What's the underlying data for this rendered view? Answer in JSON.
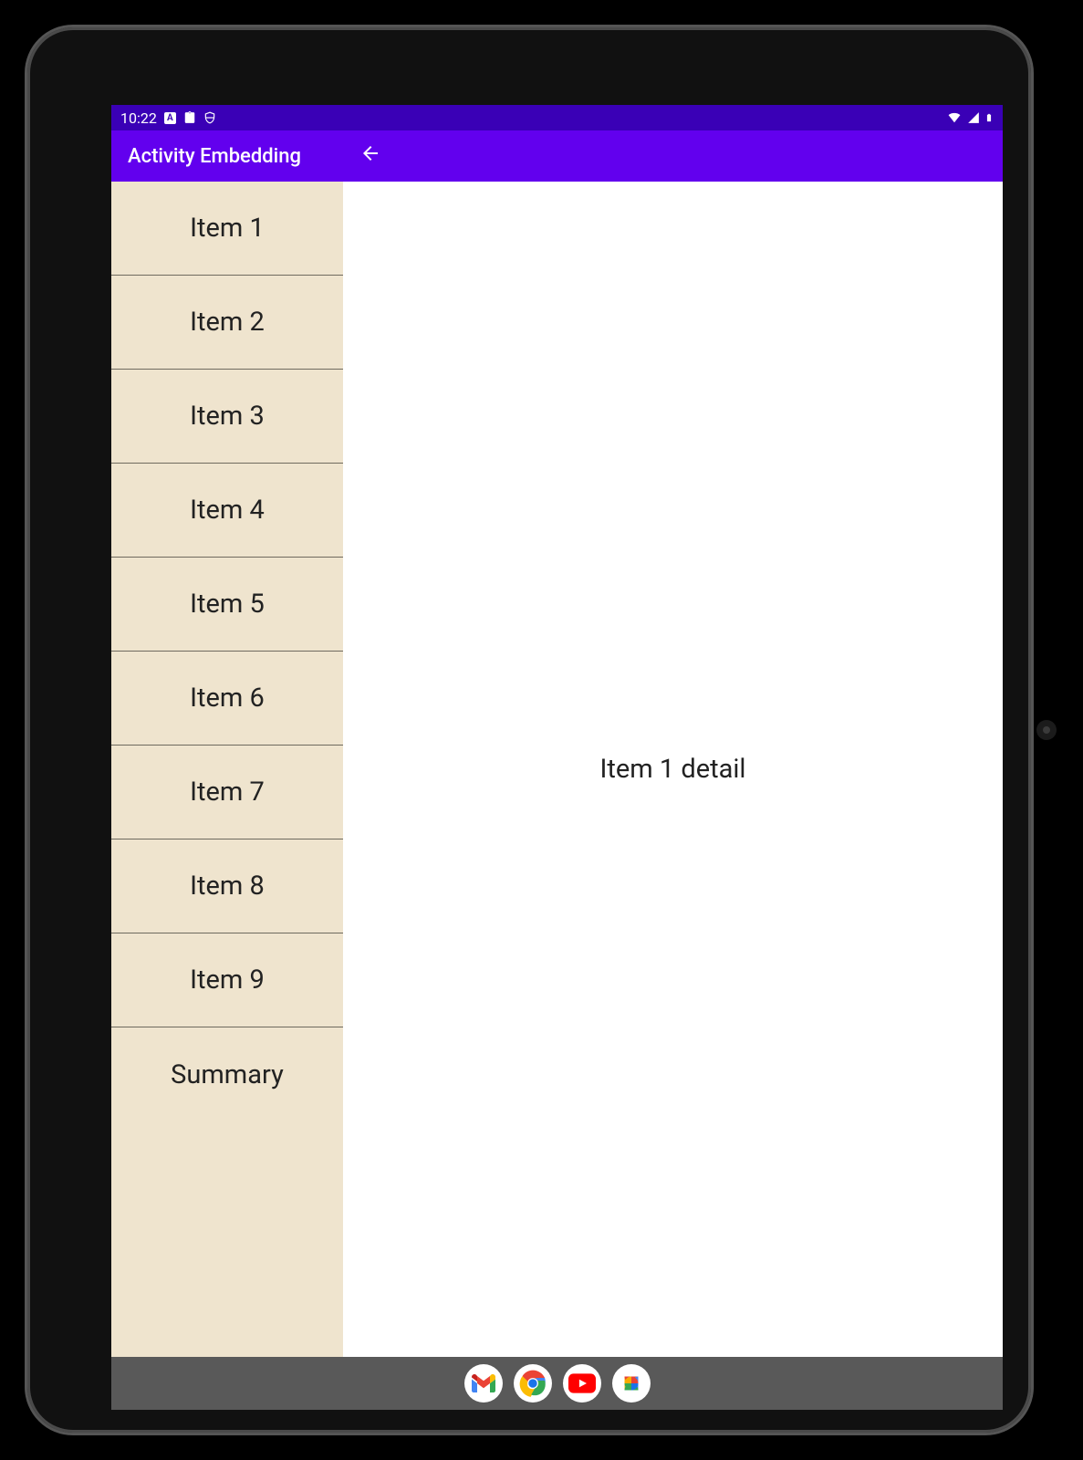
{
  "statusbar": {
    "time": "10:22"
  },
  "appbar": {
    "title": "Activity Embedding"
  },
  "list": {
    "items": [
      {
        "label": "Item 1"
      },
      {
        "label": "Item 2"
      },
      {
        "label": "Item 3"
      },
      {
        "label": "Item 4"
      },
      {
        "label": "Item 5"
      },
      {
        "label": "Item 6"
      },
      {
        "label": "Item 7"
      },
      {
        "label": "Item 8"
      },
      {
        "label": "Item 9"
      },
      {
        "label": "Summary"
      }
    ]
  },
  "detail": {
    "text": "Item 1 detail"
  }
}
